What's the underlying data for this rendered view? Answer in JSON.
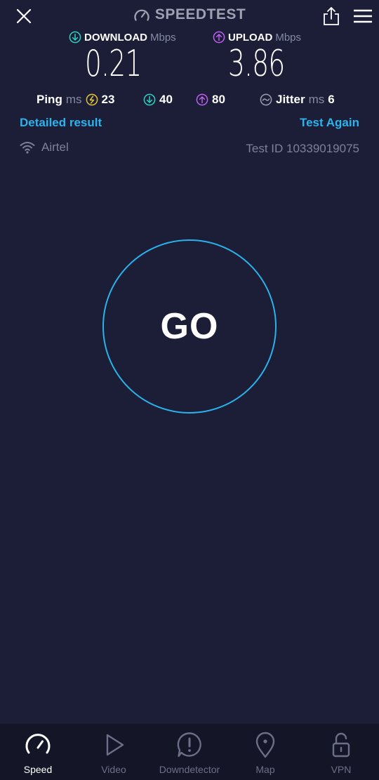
{
  "header": {
    "title": "SPEEDTEST"
  },
  "download": {
    "label": "DOWNLOAD",
    "unit": "Mbps",
    "value": "0.21",
    "icon": "download-arrow-icon",
    "color": "#2ad4c2"
  },
  "upload": {
    "label": "UPLOAD",
    "unit": "Mbps",
    "value": "3.86",
    "icon": "upload-arrow-icon",
    "color": "#c05ff0"
  },
  "ping": {
    "label": "Ping",
    "unit": "ms",
    "idle": "23",
    "download": "40",
    "upload": "80",
    "idle_color": "#e4c63b"
  },
  "jitter": {
    "label": "Jitter",
    "unit": "ms",
    "value": "6"
  },
  "links": {
    "detailed_result": "Detailed result",
    "test_again": "Test Again"
  },
  "provider": {
    "name": "Airtel",
    "test_id": "Test ID 10339019075"
  },
  "go": {
    "label": "GO",
    "ring_color": "#2bb2ea"
  },
  "nav": {
    "items": [
      {
        "label": "Speed",
        "icon": "speedometer-icon",
        "active": true
      },
      {
        "label": "Video",
        "icon": "play-icon",
        "active": false
      },
      {
        "label": "Downdetector",
        "icon": "alert-icon",
        "active": false
      },
      {
        "label": "Map",
        "icon": "map-pin-icon",
        "active": false
      },
      {
        "label": "VPN",
        "icon": "unlock-icon",
        "active": false
      }
    ]
  },
  "colors": {
    "background": "#1c1e37",
    "nav_background": "#141527",
    "accent": "#2ab3ec"
  }
}
